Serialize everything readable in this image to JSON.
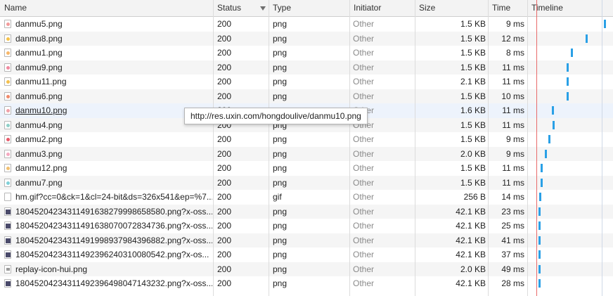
{
  "columns": {
    "name": "Name",
    "status": "Status",
    "type": "Type",
    "initiator": "Initiator",
    "size": "Size",
    "time": "Time",
    "timeline": "Timeline"
  },
  "requests": [
    {
      "name": "danmu5.png",
      "status": "200",
      "type": "png",
      "initiator": "Other",
      "size": "1.5 KB",
      "time": "9 ms",
      "icon_color": "#f29a9a"
    },
    {
      "name": "danmu8.png",
      "status": "200",
      "type": "png",
      "initiator": "Other",
      "size": "1.5 KB",
      "time": "12 ms",
      "icon_color": "#f5c24a"
    },
    {
      "name": "danmu1.png",
      "status": "200",
      "type": "png",
      "initiator": "Other",
      "size": "1.5 KB",
      "time": "8 ms",
      "icon_color": "#f7b76a"
    },
    {
      "name": "danmu9.png",
      "status": "200",
      "type": "png",
      "initiator": "Other",
      "size": "1.5 KB",
      "time": "11 ms",
      "icon_color": "#f08aa0"
    },
    {
      "name": "danmu11.png",
      "status": "200",
      "type": "png",
      "initiator": "Other",
      "size": "2.1 KB",
      "time": "11 ms",
      "icon_color": "#f4c04e"
    },
    {
      "name": "danmu6.png",
      "status": "200",
      "type": "png",
      "initiator": "Other",
      "size": "1.5 KB",
      "time": "10 ms",
      "icon_color": "#f08a6a"
    },
    {
      "name": "danmu10.png",
      "status": "200",
      "type": "png",
      "initiator": "Other",
      "size": "1.6 KB",
      "time": "11 ms",
      "icon_color": "#f0a0a8"
    },
    {
      "name": "danmu4.png",
      "status": "200",
      "type": "png",
      "initiator": "Other",
      "size": "1.5 KB",
      "time": "11 ms",
      "icon_color": "#8fd0c8"
    },
    {
      "name": "danmu2.png",
      "status": "200",
      "type": "png",
      "initiator": "Other",
      "size": "1.5 KB",
      "time": "9 ms",
      "icon_color": "#e85a6a"
    },
    {
      "name": "danmu3.png",
      "status": "200",
      "type": "png",
      "initiator": "Other",
      "size": "2.0 KB",
      "time": "9 ms",
      "icon_color": "#f5a8c0"
    },
    {
      "name": "danmu12.png",
      "status": "200",
      "type": "png",
      "initiator": "Other",
      "size": "1.5 KB",
      "time": "11 ms",
      "icon_color": "#f2c070"
    },
    {
      "name": "danmu7.png",
      "status": "200",
      "type": "png",
      "initiator": "Other",
      "size": "1.5 KB",
      "time": "11 ms",
      "icon_color": "#7fd0d8"
    },
    {
      "name": "hm.gif?cc=0&ck=1&cl=24-bit&ds=326x541&ep=%7...",
      "status": "200",
      "type": "gif",
      "initiator": "Other",
      "size": "256 B",
      "time": "14 ms",
      "icon_color": "blank"
    },
    {
      "name": "18045204234311491638279998658580.png?x-oss...",
      "status": "200",
      "type": "png",
      "initiator": "Other",
      "size": "42.1 KB",
      "time": "23 ms",
      "icon_color": "dark"
    },
    {
      "name": "18045204234311491638070072834736.png?x-oss...",
      "status": "200",
      "type": "png",
      "initiator": "Other",
      "size": "42.1 KB",
      "time": "25 ms",
      "icon_color": "dark"
    },
    {
      "name": "18045204234311491998937984396882.png?x-oss...",
      "status": "200",
      "type": "png",
      "initiator": "Other",
      "size": "42.1 KB",
      "time": "41 ms",
      "icon_color": "dark"
    },
    {
      "name": "18045204234311492396240310080542.png?x-os...",
      "status": "200",
      "type": "png",
      "initiator": "Other",
      "size": "42.1 KB",
      "time": "37 ms",
      "icon_color": "dark"
    },
    {
      "name": "replay-icon-hui.png",
      "status": "200",
      "type": "png",
      "initiator": "Other",
      "size": "2.0 KB",
      "time": "49 ms",
      "icon_color": "doc"
    },
    {
      "name": "18045204234311492396498047143232.png?x-oss...",
      "status": "200",
      "type": "png",
      "initiator": "Other",
      "size": "42.1 KB",
      "time": "28 ms",
      "icon_color": "dark"
    }
  ],
  "tooltip": "http://res.uxin.com/hongdoulive/danmu10.png",
  "accent": {
    "timeline_bar": "#2aa0e6",
    "load_marker": "#e86a6a"
  }
}
